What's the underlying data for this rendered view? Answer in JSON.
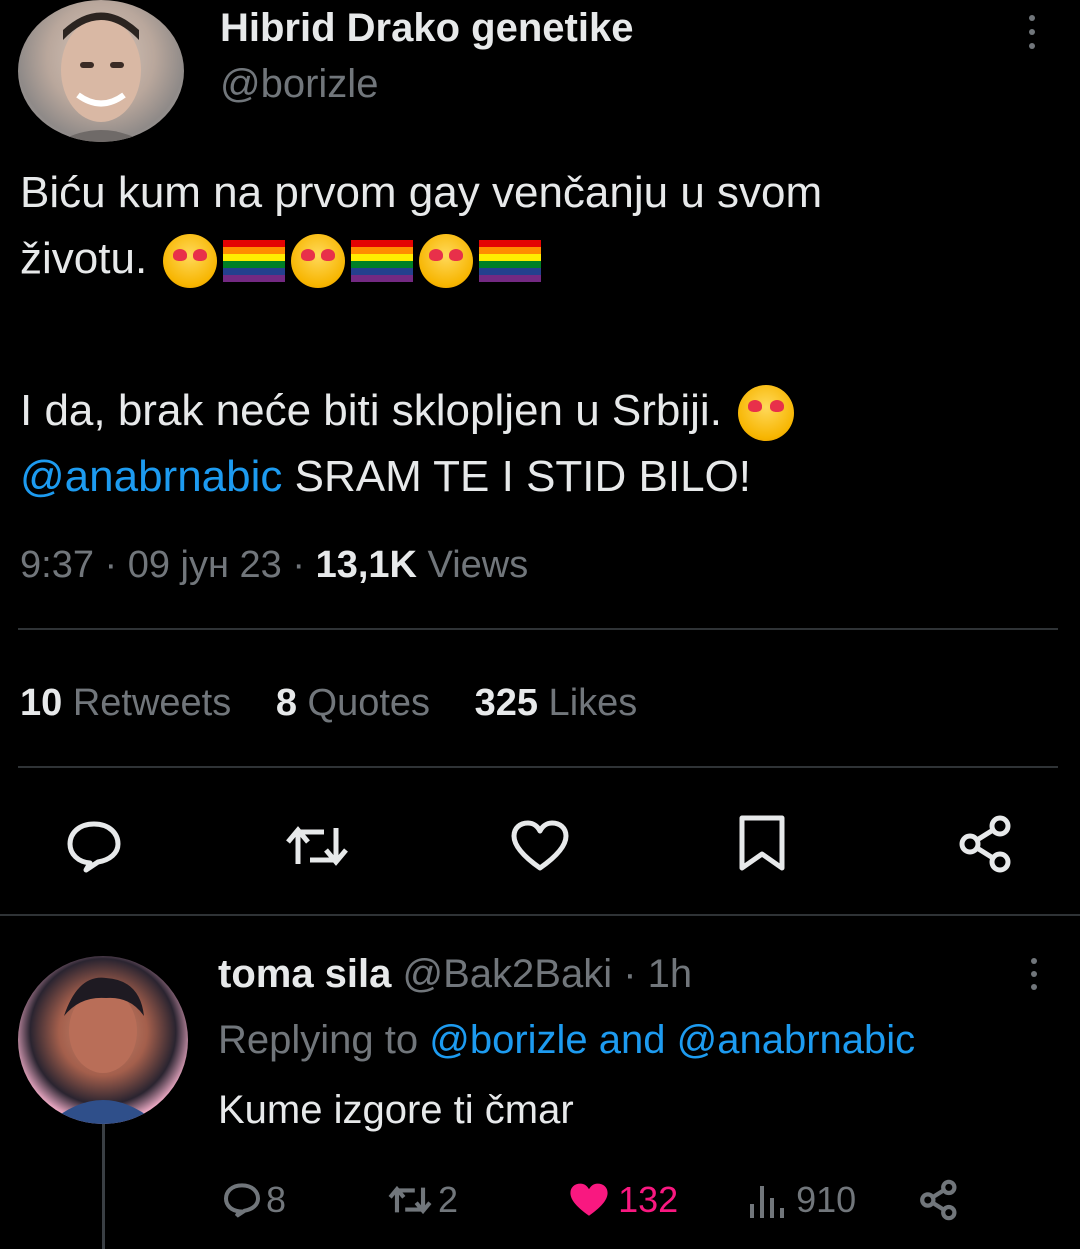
{
  "tweet": {
    "author_name": "Hibrid Drako genetike",
    "author_handle": "@borizle",
    "text_line1": "Biću kum na prvom gay venčanju u svom",
    "text_line2_word": "životu.",
    "text_line3": "I da, brak neće biti sklopljen u Srbiji.",
    "mention": "@anabrnabic",
    "text_after_mention": " SRAM TE I STID BILO!",
    "meta_time": "9:37 · 09 јун 23 · ",
    "views_count": "13,1K",
    "views_label": " Views",
    "retweets_count": "10",
    "retweets_label": " Retweets",
    "quotes_count": "8",
    "quotes_label": " Quotes",
    "likes_count": "325",
    "likes_label": " Likes"
  },
  "reply": {
    "author_name": "toma sila",
    "author_handle": " @Bak2Baki · 1h",
    "replying_prefix": "Replying to ",
    "replying_targets": "@borizle and @anabrnabic",
    "text": "Kume izgore ti čmar",
    "reply_count": "8",
    "retweet_count": "2",
    "like_count": "132",
    "views_count": "910"
  },
  "colors": {
    "accent": "#1d9bf0",
    "like": "#f91880",
    "muted": "#71767b",
    "background": "#000000"
  },
  "icons": [
    "more-icon",
    "reply-icon",
    "retweet-icon",
    "like-icon",
    "bookmark-icon",
    "share-icon",
    "views-icon",
    "heart-filled-icon"
  ]
}
